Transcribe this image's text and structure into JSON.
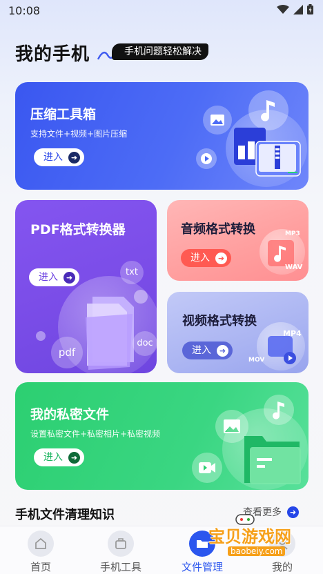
{
  "status_bar": {
    "time": "10:08"
  },
  "header": {
    "title": "我的手机",
    "subtitle": "手机问题轻松解决"
  },
  "cards": {
    "compress": {
      "title": "压缩工具箱",
      "desc": "支持文件+视频+图片压缩",
      "button": "进入"
    },
    "pdf": {
      "title": "PDF格式转换器",
      "button": "进入",
      "icon_labels": [
        "txt",
        "doc",
        "pdf"
      ]
    },
    "audio": {
      "title": "音频格式转换",
      "button": "进入",
      "icon_labels": [
        "MP3",
        "WAV"
      ]
    },
    "video": {
      "title": "视频格式转换",
      "button": "进入",
      "icon_labels": [
        "MP4",
        "MOV"
      ]
    },
    "private": {
      "title": "我的私密文件",
      "desc": "设置私密文件+私密相片+私密视频",
      "button": "进入"
    }
  },
  "section": {
    "title": "手机文件清理知识",
    "more": "查看更多"
  },
  "bottom_nav": [
    {
      "label": "首页",
      "icon": "home-icon"
    },
    {
      "label": "手机工具",
      "icon": "toolbox-icon"
    },
    {
      "label": "文件管理",
      "icon": "folder-icon"
    },
    {
      "label": "我的",
      "icon": "user-icon"
    }
  ],
  "active_tab": "文件管理",
  "watermark": {
    "text": "宝贝游戏网",
    "url": "baobeiy.com"
  },
  "colors": {
    "primary_blue": "#3a57f0",
    "pdf_purple": "#7b4de8",
    "audio_pink": "#ff9e9e",
    "video_lavender": "#aab4f2",
    "private_green": "#2ccf71"
  }
}
